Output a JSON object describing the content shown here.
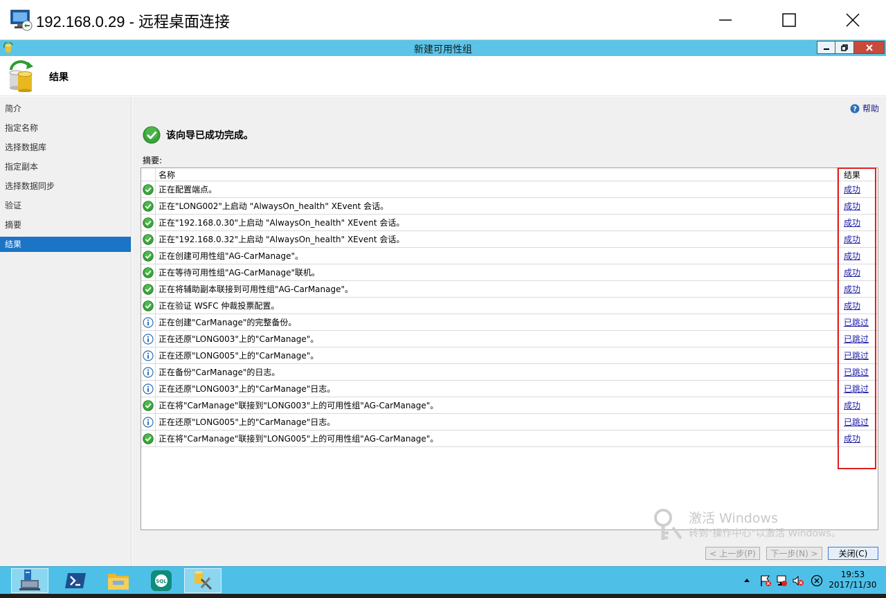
{
  "rdp": {
    "title": "192.168.0.29 - 远程桌面连接"
  },
  "window": {
    "title": "新建可用性组"
  },
  "header": {
    "title": "结果"
  },
  "sidebar": {
    "items": [
      {
        "label": "简介"
      },
      {
        "label": "指定名称"
      },
      {
        "label": "选择数据库"
      },
      {
        "label": "指定副本"
      },
      {
        "label": "选择数据同步"
      },
      {
        "label": "验证"
      },
      {
        "label": "摘要"
      },
      {
        "label": "结果"
      }
    ],
    "active_index": 7
  },
  "main": {
    "help_label": "帮助",
    "complete_message": "该向导已成功完成。",
    "summary_label": "摘要:",
    "grid": {
      "columns": {
        "name": "名称",
        "result": "结果"
      },
      "rows": [
        {
          "status": "success",
          "name": "正在配置端点。",
          "result": "成功"
        },
        {
          "status": "success",
          "name": "正在\"LONG002\"上启动 \"AlwaysOn_health\" XEvent 会话。",
          "result": "成功"
        },
        {
          "status": "success",
          "name": "正在\"192.168.0.30\"上启动 \"AlwaysOn_health\" XEvent 会话。",
          "result": "成功"
        },
        {
          "status": "success",
          "name": "正在\"192.168.0.32\"上启动 \"AlwaysOn_health\" XEvent 会话。",
          "result": "成功"
        },
        {
          "status": "success",
          "name": "正在创建可用性组\"AG-CarManage\"。",
          "result": "成功"
        },
        {
          "status": "success",
          "name": "正在等待可用性组\"AG-CarManage\"联机。",
          "result": "成功"
        },
        {
          "status": "success",
          "name": "正在将辅助副本联接到可用性组\"AG-CarManage\"。",
          "result": "成功"
        },
        {
          "status": "success",
          "name": "正在验证 WSFC 仲裁投票配置。",
          "result": "成功"
        },
        {
          "status": "info",
          "name": "正在创建\"CarManage\"的完整备份。",
          "result": "已跳过"
        },
        {
          "status": "info",
          "name": "正在还原\"LONG003\"上的\"CarManage\"。",
          "result": "已跳过"
        },
        {
          "status": "info",
          "name": "正在还原\"LONG005\"上的\"CarManage\"。",
          "result": "已跳过"
        },
        {
          "status": "info",
          "name": "正在备份\"CarManage\"的日志。",
          "result": "已跳过"
        },
        {
          "status": "info",
          "name": "正在还原\"LONG003\"上的\"CarManage\"日志。",
          "result": "已跳过"
        },
        {
          "status": "success",
          "name": "正在将\"CarManage\"联接到\"LONG003\"上的可用性组\"AG-CarManage\"。",
          "result": "成功"
        },
        {
          "status": "info",
          "name": "正在还原\"LONG005\"上的\"CarManage\"日志。",
          "result": "已跳过"
        },
        {
          "status": "success",
          "name": "正在将\"CarManage\"联接到\"LONG005\"上的可用性组\"AG-CarManage\"。",
          "result": "成功"
        }
      ]
    }
  },
  "watermark": {
    "title": "激活 Windows",
    "subtitle": "转到\"操作中心\"以激活 Windows。"
  },
  "buttons": {
    "prev": "< 上一步(P)",
    "next": "下一步(N) >",
    "close": "关闭(C)"
  },
  "taskbar": {
    "items": [
      {
        "icon": "server-manager-icon"
      },
      {
        "icon": "powershell-icon"
      },
      {
        "icon": "file-explorer-icon"
      },
      {
        "icon": "sql-server-icon"
      },
      {
        "icon": "management-studio-icon"
      }
    ],
    "time": "19:53",
    "date": "2017/11/30"
  },
  "colors": {
    "accent": "#1b74c5",
    "title_bar": "#5bc4e8",
    "taskbar": "#4ec0e8",
    "success": "#3aa43a",
    "info": "#2e6fb8",
    "link": "#1a1aa8",
    "highlight_box": "#e02020"
  }
}
